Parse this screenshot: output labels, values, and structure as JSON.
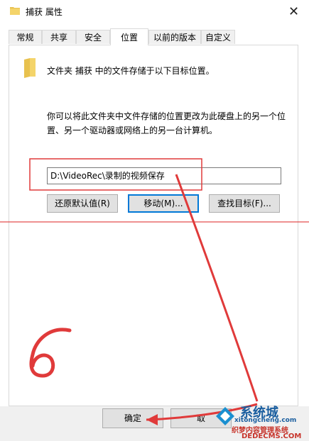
{
  "window": {
    "title": "捕获 属性",
    "close_glyph": "✕"
  },
  "tabs": [
    {
      "label": "常规"
    },
    {
      "label": "共享"
    },
    {
      "label": "安全"
    },
    {
      "label": "位置"
    },
    {
      "label": "以前的版本"
    },
    {
      "label": "自定义"
    }
  ],
  "location": {
    "info": "文件夹 捕获 中的文件存储于以下目标位置。",
    "description": "你可以将此文件夹中文件存储的位置更改为此硬盘上的另一个位置、另一个驱动器或网络上的另一台计算机。",
    "path": "D:\\VideoRec\\录制的视频保存",
    "restore_label": "还原默认值(R)",
    "move_label": "移动(M)...",
    "find_label": "查找目标(F)..."
  },
  "footer": {
    "ok_label": "确定",
    "cancel_label": "取"
  },
  "annotation": {
    "step_number": "6"
  },
  "watermark": {
    "line1": "系统城",
    "line2": "xitongcheng.com",
    "line3": "织梦内容管理系统",
    "line4": "DEDECMS.COM"
  },
  "colors": {
    "annotation_red": "#e03a3a",
    "focus_blue": "#0078d7",
    "folder_yellow": "#e8c14e"
  }
}
